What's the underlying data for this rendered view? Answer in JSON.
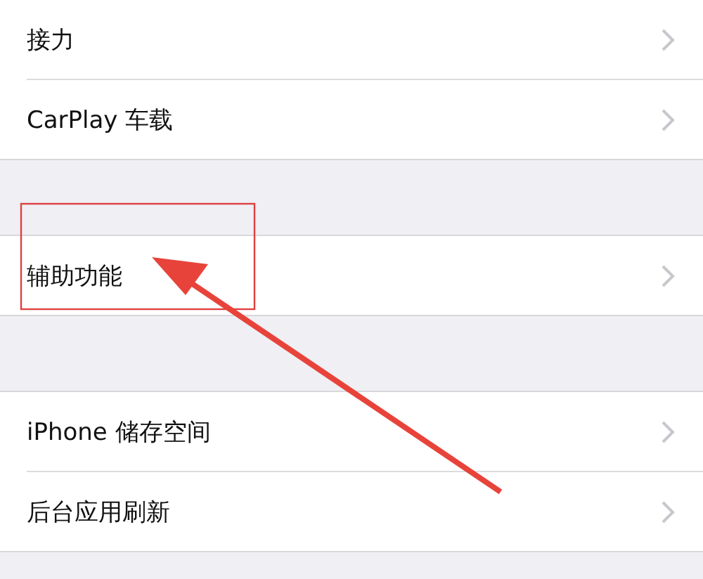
{
  "groups": [
    {
      "rows": [
        {
          "label": "接力"
        },
        {
          "label": "CarPlay 车载"
        }
      ]
    },
    {
      "rows": [
        {
          "label": "辅助功能"
        }
      ]
    },
    {
      "rows": [
        {
          "label": "iPhone 储存空间"
        },
        {
          "label": "后台应用刷新"
        }
      ]
    }
  ]
}
